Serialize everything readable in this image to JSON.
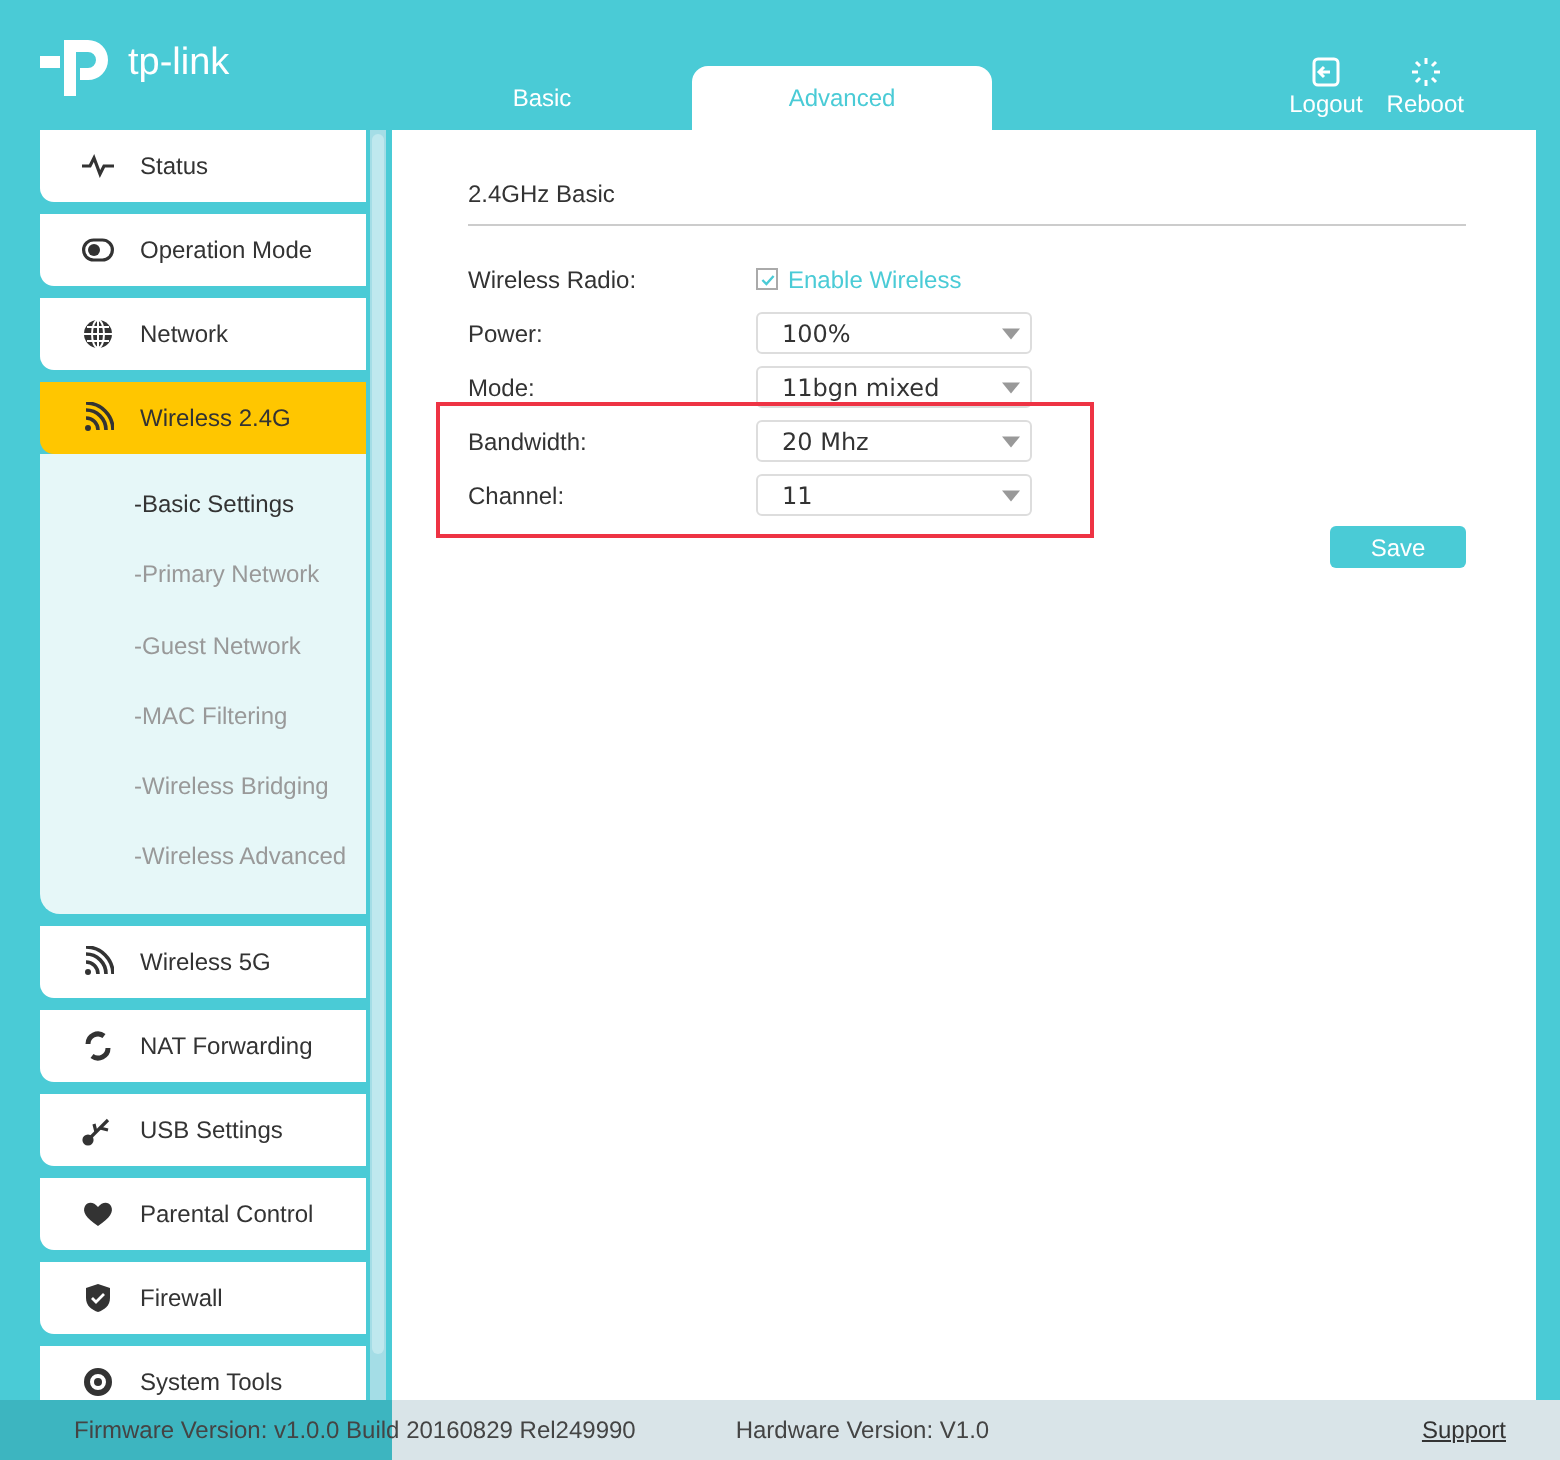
{
  "header": {
    "logo": "tp-link",
    "tabs": [
      {
        "label": "Basic",
        "selected": false
      },
      {
        "label": "Advanced",
        "selected": true
      }
    ],
    "actions": [
      {
        "kind": "logout",
        "label": "Logout"
      },
      {
        "kind": "reboot",
        "label": "Reboot"
      }
    ]
  },
  "sidebar": {
    "items": [
      {
        "label": "Status",
        "selected": false
      },
      {
        "label": "Operation Mode",
        "selected": false
      },
      {
        "label": "Network",
        "selected": false
      },
      {
        "label": "Wireless 2.4G",
        "selected": true,
        "children": [
          {
            "label": "-Basic Settings",
            "selected": true
          },
          {
            "label": "-Primary Network",
            "selected": false
          },
          {
            "label": "-Guest Network",
            "selected": false
          },
          {
            "label": "-MAC Filtering",
            "selected": false
          },
          {
            "label": "-Wireless Bridging",
            "selected": false
          },
          {
            "label": "-Wireless Advanced",
            "selected": false
          }
        ]
      },
      {
        "label": "Wireless 5G",
        "selected": false
      },
      {
        "label": "NAT Forwarding",
        "selected": false
      },
      {
        "label": "USB Settings",
        "selected": false
      },
      {
        "label": "Parental Control",
        "selected": false
      },
      {
        "label": "Firewall",
        "selected": false
      },
      {
        "label": "System Tools",
        "selected": false
      }
    ]
  },
  "main": {
    "section_title": "2.4GHz Basic",
    "fields": [
      {
        "kind": "checkbox",
        "label": "Wireless Radio:",
        "option": "Enable Wireless",
        "checked": true,
        "highlighted": false
      },
      {
        "kind": "select",
        "label": "Power:",
        "value": "100%",
        "highlighted": false
      },
      {
        "kind": "select",
        "label": "Mode:",
        "value": "11bgn mixed",
        "highlighted": false
      },
      {
        "kind": "select",
        "label": "Bandwidth:",
        "value": "20 Mhz",
        "highlighted": true
      },
      {
        "kind": "select",
        "label": "Channel:",
        "value": "11",
        "highlighted": true
      }
    ],
    "save_button": "Save"
  },
  "footer": {
    "firmware": "Firmware Version: v1.0.0 Build 20160829 Rel249990",
    "hardware": "Hardware Version: V1.0",
    "support_link": "Support"
  }
}
